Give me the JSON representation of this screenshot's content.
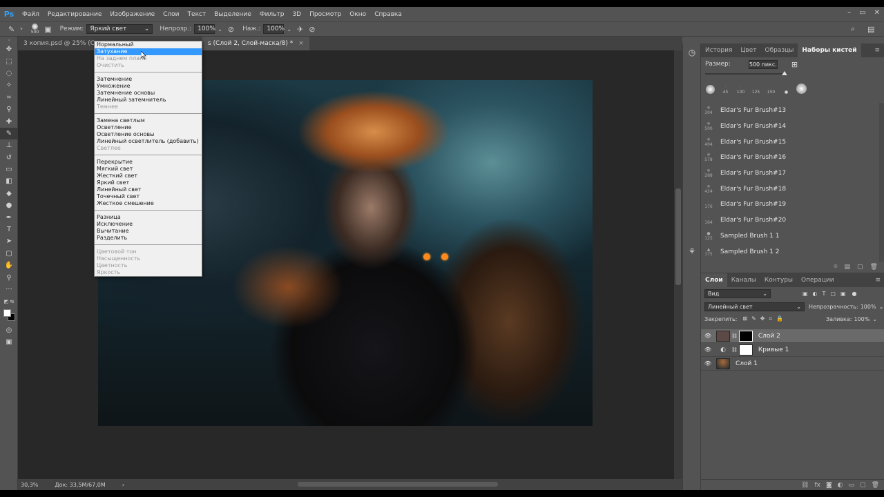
{
  "menu": {
    "logo": "Ps",
    "items": [
      "Файл",
      "Редактирование",
      "Изображение",
      "Слои",
      "Текст",
      "Выделение",
      "Фильтр",
      "3D",
      "Просмотр",
      "Окно",
      "Справка"
    ]
  },
  "window_controls": {
    "minimize": "–",
    "restore": "▭",
    "close": "✕"
  },
  "options_bar": {
    "brush_size": "500",
    "mode_label": "Режим:",
    "mode_value": "Яркий свет",
    "opacity_label": "Непрозр.:",
    "opacity_value": "100%",
    "pressure_label": "Наж.:",
    "pressure_value": "100%"
  },
  "doc_tabs": {
    "tab1": "3 копия.psd @ 25% (Сло",
    "tab2": "s (Слой 2, Слой-маска/8) *",
    "close": "×"
  },
  "blend_dropdown": {
    "groups": [
      [
        {
          "label": "Нормальный",
          "state": "normal"
        },
        {
          "label": "Затухание",
          "state": "hover"
        },
        {
          "label": "На заднем плане",
          "state": "disabled"
        },
        {
          "label": "Очистить",
          "state": "disabled"
        }
      ],
      [
        {
          "label": "Затемнение",
          "state": "normal"
        },
        {
          "label": "Умножение",
          "state": "normal"
        },
        {
          "label": "Затемнение основы",
          "state": "normal"
        },
        {
          "label": "Линейный затемнитель",
          "state": "normal"
        },
        {
          "label": "Темнее",
          "state": "disabled"
        }
      ],
      [
        {
          "label": "Замена светлым",
          "state": "normal"
        },
        {
          "label": "Осветление",
          "state": "normal"
        },
        {
          "label": "Осветление основы",
          "state": "normal"
        },
        {
          "label": "Линейный осветлитель (добавить)",
          "state": "normal"
        },
        {
          "label": "Светлее",
          "state": "disabled"
        }
      ],
      [
        {
          "label": "Перекрытие",
          "state": "normal"
        },
        {
          "label": "Мягкий свет",
          "state": "normal"
        },
        {
          "label": "Жесткий свет",
          "state": "normal"
        },
        {
          "label": "Яркий свет",
          "state": "normal"
        },
        {
          "label": "Линейный свет",
          "state": "normal"
        },
        {
          "label": "Точечный свет",
          "state": "normal"
        },
        {
          "label": "Жесткое смешение",
          "state": "normal"
        }
      ],
      [
        {
          "label": "Разница",
          "state": "normal"
        },
        {
          "label": "Исключение",
          "state": "normal"
        },
        {
          "label": "Вычитание",
          "state": "normal"
        },
        {
          "label": "Разделить",
          "state": "normal"
        }
      ],
      [
        {
          "label": "Цветовой тон",
          "state": "disabled"
        },
        {
          "label": "Насыщенность",
          "state": "disabled"
        },
        {
          "label": "Цветность",
          "state": "disabled"
        },
        {
          "label": "Яркость",
          "state": "disabled"
        }
      ]
    ]
  },
  "status": {
    "zoom": "30,3%",
    "doc": "Док: 33,5M/67,0M",
    "arrow": "›"
  },
  "panel_tabs": [
    "История",
    "Цвет",
    "Образцы",
    "Наборы кистей"
  ],
  "brush_panel": {
    "size_label": "Размер:",
    "size_value": "500 пикс.",
    "presets": [
      "",
      "45",
      "100",
      "125",
      "150",
      "",
      ""
    ],
    "brushes": [
      {
        "thumb": "304",
        "name": "Eldar's Fur Brush#13"
      },
      {
        "thumb": "500",
        "name": "Eldar's Fur Brush#14"
      },
      {
        "thumb": "404",
        "name": "Eldar's Fur Brush#15"
      },
      {
        "thumb": "578",
        "name": "Eldar's Fur Brush#16"
      },
      {
        "thumb": "288",
        "name": "Eldar's Fur Brush#17"
      },
      {
        "thumb": "424",
        "name": "Eldar's Fur Brush#18"
      },
      {
        "thumb": "176",
        "name": "Eldar's Fur Brush#19"
      },
      {
        "thumb": "164",
        "name": "Eldar's Fur Brush#20"
      },
      {
        "thumb": "125",
        "name": "Sampled Brush 1 1"
      },
      {
        "thumb": "175",
        "name": "Sampled Brush 1 2"
      }
    ]
  },
  "layers_panel": {
    "tabs": [
      "Слои",
      "Каналы",
      "Контуры",
      "Операции"
    ],
    "filter_value": "Вид",
    "blend_mode": "Линейный свет",
    "opacity_label": "Непрозрачность:",
    "opacity_value": "100%",
    "lock_label": "Закрепить:",
    "fill_label": "Заливка:",
    "fill_value": "100%",
    "layers": [
      {
        "name": "Слой 2",
        "selected": true
      },
      {
        "name": "Кривые 1",
        "selected": false
      },
      {
        "name": "Слой 1",
        "selected": false
      }
    ]
  }
}
